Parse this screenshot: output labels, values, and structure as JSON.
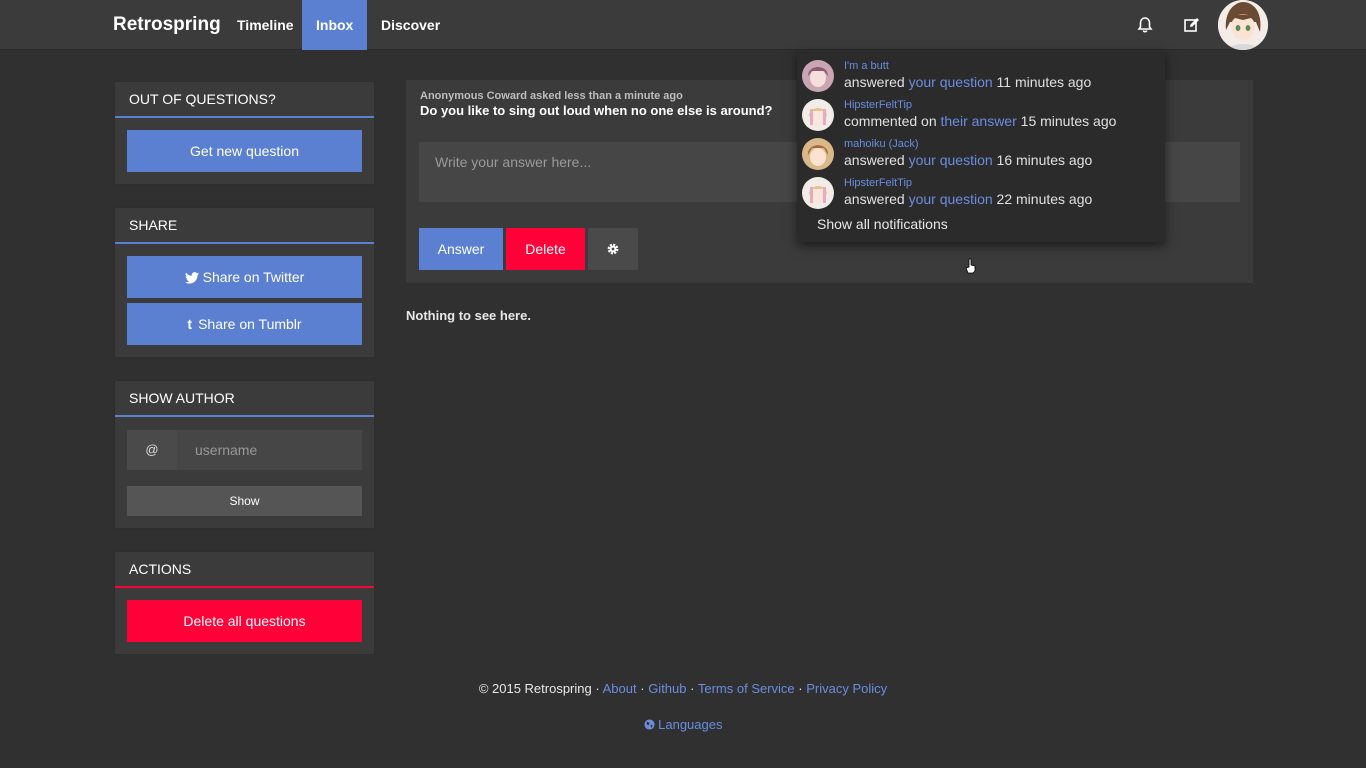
{
  "navbar": {
    "brand": "Retrospring",
    "items": [
      {
        "label": "Timeline"
      },
      {
        "label": "Inbox"
      },
      {
        "label": "Discover"
      }
    ],
    "icons": [
      "bell-icon",
      "compose-icon"
    ]
  },
  "sidebar": {
    "out_of_questions": {
      "title": "OUT OF QUESTIONS?",
      "button": "Get new question"
    },
    "share": {
      "title": "SHARE",
      "twitter": "Share on Twitter",
      "tumblr": "Share on Tumblr"
    },
    "show_author": {
      "title": "SHOW AUTHOR",
      "at": "@",
      "placeholder": "username",
      "button": "Show"
    },
    "actions": {
      "title": "ACTIONS",
      "button": "Delete all questions"
    }
  },
  "inbox": {
    "asker": "Anonymous Coward asked less than a minute ago",
    "question": "Do you like to sing out loud when no one else is around?",
    "answer_placeholder": "Write your answer here...",
    "answer_button": "Answer",
    "delete_button": "Delete",
    "empty": "Nothing to see here."
  },
  "notifications": {
    "items": [
      {
        "user": "I'm a butt",
        "verb": "answered",
        "target": "your question",
        "time": "11 minutes ago"
      },
      {
        "user": "HipsterFeltTip",
        "verb": "commented on",
        "target": "their answer",
        "time": "15 minutes ago"
      },
      {
        "user": "mahoiku (Jack)",
        "verb": "answered",
        "target": "your question",
        "time": "16 minutes ago"
      },
      {
        "user": "HipsterFeltTip",
        "verb": "answered",
        "target": "your question",
        "time": "22 minutes ago"
      }
    ],
    "show_all": "Show all notifications"
  },
  "footer": {
    "copyright": "© 2015 Retrospring",
    "sep": "·",
    "about": "About",
    "github": "Github",
    "terms": "Terms of Service",
    "privacy": "Privacy Policy",
    "languages": "Languages"
  },
  "colors": {
    "accent": "#5b7fd1",
    "danger": "#ff0039",
    "background": "#303030",
    "panel": "#3b3b3b"
  }
}
